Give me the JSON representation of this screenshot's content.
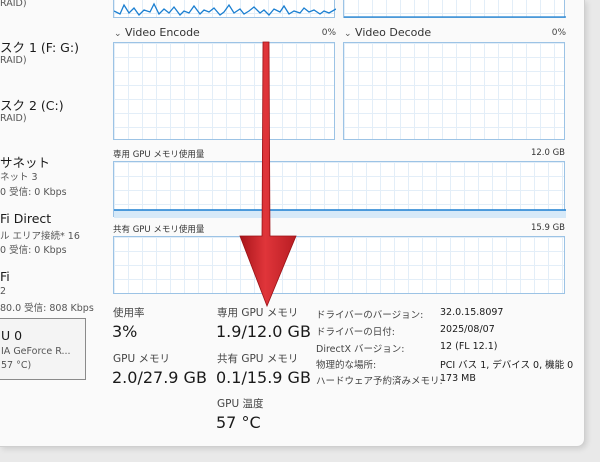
{
  "sidebar": {
    "items": [
      {
        "title": "",
        "sub": "RAID)"
      },
      {
        "title": "スク 1 (F: G:)",
        "sub": "RAID)"
      },
      {
        "title": "スク 2 (C:)",
        "sub": "RAID)"
      },
      {
        "title": "サネット",
        "sub": "ネット 3",
        "sub2": "0 受信: 0 Kbps"
      },
      {
        "title": "Fi Direct",
        "sub": "ル エリア接続* 16",
        "sub2": "0 受信: 0 Kbps"
      },
      {
        "title": "Fi",
        "sub": "2",
        "sub2": "80.0 受信: 808 Kbps"
      },
      {
        "title": "U 0",
        "sub": "IA GeForce R...",
        "sub2": "57 °C)"
      }
    ]
  },
  "panels": {
    "video_encode": {
      "label": "Video Encode",
      "pct": "0%"
    },
    "video_decode": {
      "label": "Video Decode",
      "pct": "0%"
    },
    "dedicated": {
      "label": "専用 GPU メモリ使用量",
      "max": "12.0 GB"
    },
    "shared": {
      "label": "共有 GPU メモリ使用量",
      "max": "15.9 GB"
    }
  },
  "stats": {
    "usage_label": "使用率",
    "usage_value": "3%",
    "gpu_mem_label": "GPU メモリ",
    "gpu_mem_value": "2.0/27.9 GB",
    "dedicated_label": "専用 GPU メモリ",
    "dedicated_value": "1.9/12.0 GB",
    "shared_label": "共有 GPU メモリ",
    "shared_value": "0.1/15.9 GB",
    "temp_label": "GPU 温度",
    "temp_value": "57 °C"
  },
  "info": [
    {
      "key": "ドライバーのバージョン:",
      "value": "32.0.15.8097"
    },
    {
      "key": "ドライバーの日付:",
      "value": "2025/08/07"
    },
    {
      "key": "DirectX バージョン:",
      "value": "12 (FL 12.1)"
    },
    {
      "key": "物理的な場所:",
      "value": "PCI バス 1, デバイス 0, 機能 0"
    },
    {
      "key": "ハードウェア予約済みメモリ:",
      "value": "173 MB"
    }
  ],
  "colors": {
    "graph_line": "#1b7fd1",
    "arrow": "#d0252b"
  },
  "icons": {
    "collapse": "chevron-down-icon",
    "annotation": "red-down-arrow"
  }
}
